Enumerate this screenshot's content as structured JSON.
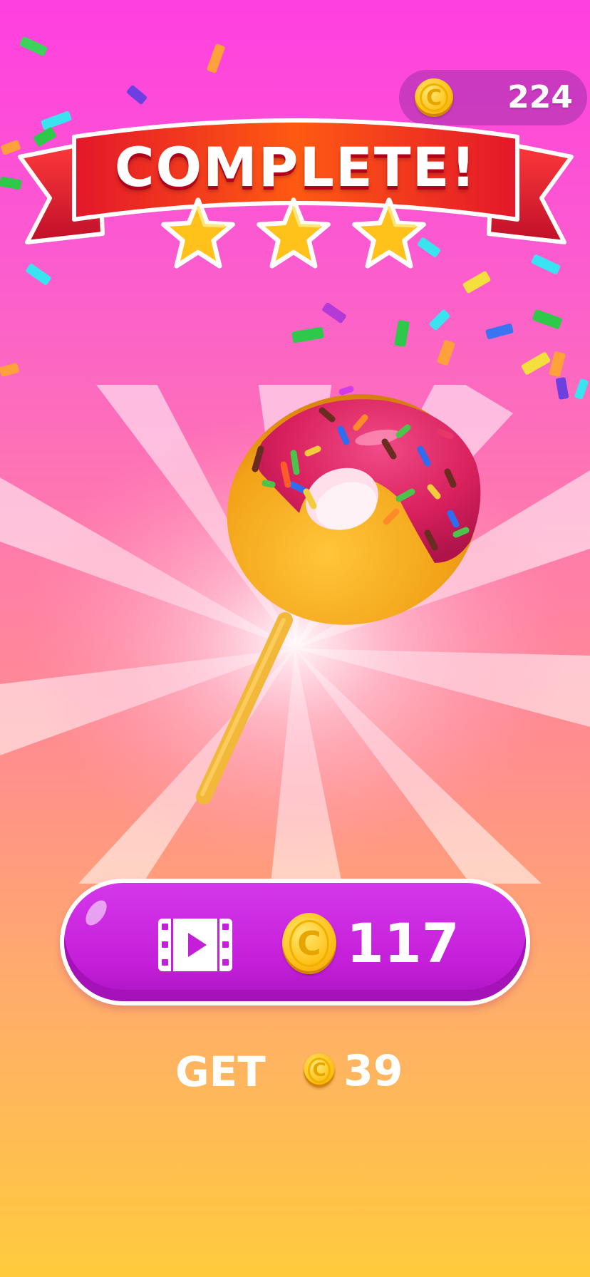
{
  "header": {
    "coin_balance": "224",
    "coin_icon": "coin-icon"
  },
  "banner": {
    "title": "COMPLETE!",
    "stars_earned": 3,
    "stars_total": 3
  },
  "reward": {
    "video_button_icon": "video-play-icon",
    "video_reward": "117",
    "get_label": "GET",
    "get_reward": "39"
  },
  "colors": {
    "background_top": "#ff3fe0",
    "background_bottom": "#ffcb3d",
    "banner_red": "#e5142c",
    "button_purple": "#c41ed8",
    "coin_gold": "#ffc21b",
    "star_gold": "#ffc21b"
  }
}
